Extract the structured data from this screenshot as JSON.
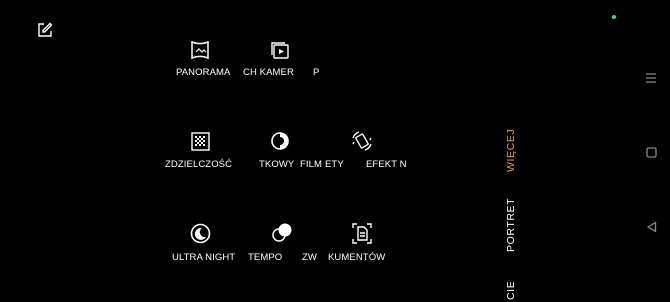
{
  "top": {
    "edit_icon": "edit-icon",
    "status_dot_color": "#3ddc84"
  },
  "modes": {
    "panorama": "PANORAMA",
    "dual_camera": "CH KAMER",
    "clip_p": "P",
    "szczegolowosc": "ZDZIELCZOŚĆ",
    "tkowy": "TKOWY",
    "film": "FILM",
    "ety": "ETY",
    "efekt": "EFEKT N",
    "ultra_night": "ULTRA NIGHT",
    "tempo": "TEMPO",
    "zw": "ZW",
    "dokumentow": "KUMENTÓW"
  },
  "side_tabs": {
    "wiecej": "WIĘCEJ",
    "portret": "PORTRET",
    "cie": "CIE"
  },
  "colors": {
    "active_tab": "#e9a03b",
    "inactive_tab": "#ffffff",
    "nav_icons": "#8a8a8a"
  },
  "nav": {
    "menu_icon": "menu-icon",
    "home_icon": "square-home-icon",
    "back_icon": "back-triangle-icon"
  }
}
